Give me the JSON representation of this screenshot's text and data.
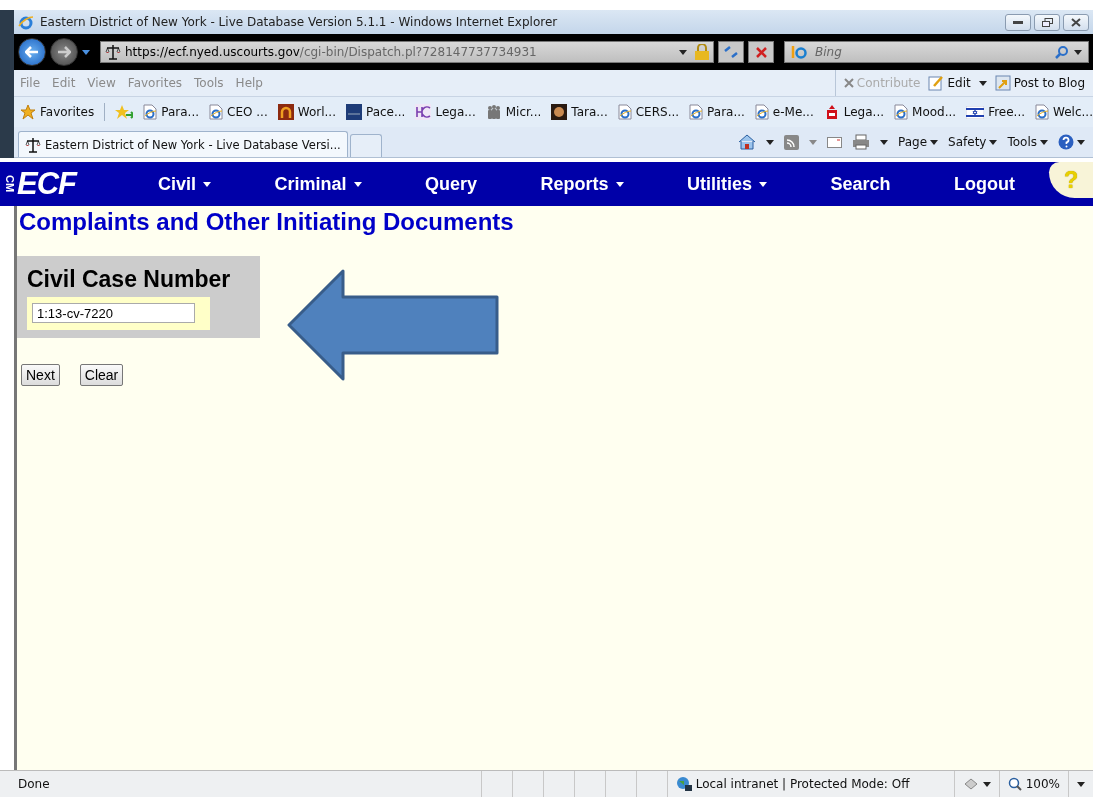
{
  "window": {
    "title": "Eastern District of New York - Live Database Version 5.1.1 - Windows Internet Explorer"
  },
  "address_bar": {
    "host": "https://ecf.nyed.uscourts.gov",
    "path": "/cgi-bin/Dispatch.pl?728147737734931"
  },
  "search_box": {
    "placeholder": "Bing"
  },
  "menu_bar": [
    "File",
    "Edit",
    "View",
    "Favorites",
    "Tools",
    "Help"
  ],
  "command_links": [
    {
      "label": "Contribute",
      "disabled": true,
      "kind": "close"
    },
    {
      "label": "Edit",
      "disabled": false,
      "kind": "edit"
    },
    {
      "label": "Post to Blog",
      "disabled": false,
      "kind": "blog"
    }
  ],
  "favorites_bar": {
    "label": "Favorites",
    "links": [
      {
        "label": "Para...",
        "kind": "page"
      },
      {
        "label": "CEO ...",
        "kind": "page"
      },
      {
        "label": "Worl...",
        "kind": "arch"
      },
      {
        "label": "Pace...",
        "kind": "banner"
      },
      {
        "label": "Lega...",
        "kind": "letters"
      },
      {
        "label": "Micr...",
        "kind": "people"
      },
      {
        "label": "Tara...",
        "kind": "portrait"
      },
      {
        "label": "CERS...",
        "kind": "page"
      },
      {
        "label": "Para...",
        "kind": "page"
      },
      {
        "label": "e-Me...",
        "kind": "page"
      },
      {
        "label": "Lega...",
        "kind": "building"
      },
      {
        "label": "Mood...",
        "kind": "page"
      },
      {
        "label": "Free...",
        "kind": "flag"
      },
      {
        "label": "Welc...",
        "kind": "page"
      }
    ]
  },
  "tabs": [
    {
      "label": "Eastern District of New York - Live Database Versi...",
      "selected": true
    }
  ],
  "command_bar": [
    "Page",
    "Safety",
    "Tools"
  ],
  "ecf_nav": {
    "logo_prefix": "CM",
    "logo": "ECF",
    "items": [
      {
        "label": "Civil",
        "dropdown": true
      },
      {
        "label": "Criminal",
        "dropdown": true
      },
      {
        "label": "Query",
        "dropdown": false
      },
      {
        "label": "Reports",
        "dropdown": true
      },
      {
        "label": "Utilities",
        "dropdown": true
      },
      {
        "label": "Search",
        "dropdown": false
      },
      {
        "label": "Logout",
        "dropdown": false
      }
    ],
    "help": "?"
  },
  "page": {
    "heading": "Complaints and Other Initiating Documents",
    "field_label": "Civil Case Number",
    "field_value": "1:13-cv-7220",
    "buttons": [
      "Next",
      "Clear"
    ]
  },
  "status_bar": {
    "text": "Done",
    "zone": "Local intranet | Protected Mode: Off",
    "zoom": "100%"
  }
}
